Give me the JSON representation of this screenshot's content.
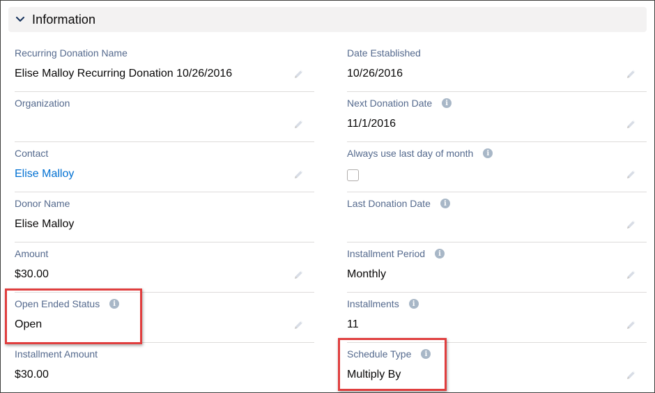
{
  "section": {
    "title": "Information",
    "toggle_icon": "chevron-down-icon"
  },
  "left_fields": [
    {
      "label": "Recurring Donation Name",
      "value": "Elise Malloy Recurring Donation 10/26/2016",
      "info": false
    },
    {
      "label": "Organization",
      "value": "",
      "info": false
    },
    {
      "label": "Contact",
      "value": "Elise Malloy",
      "info": false,
      "link": true
    },
    {
      "label": "Donor Name",
      "value": "Elise Malloy",
      "info": false
    },
    {
      "label": "Amount",
      "value": "$30.00",
      "info": false
    },
    {
      "label": "Open Ended Status",
      "value": "Open",
      "info": true,
      "highlighted": true
    },
    {
      "label": "Installment Amount",
      "value": "$30.00",
      "info": false
    }
  ],
  "right_fields": [
    {
      "label": "Date Established",
      "value": "10/26/2016",
      "info": false
    },
    {
      "label": "Next Donation Date",
      "value": "11/1/2016",
      "info": true
    },
    {
      "label": "Always use last day of month",
      "value": "",
      "info": true,
      "checkbox": true,
      "checked": false
    },
    {
      "label": "Last Donation Date",
      "value": "",
      "info": true
    },
    {
      "label": "Installment Period",
      "value": "Monthly",
      "info": true
    },
    {
      "label": "Installments",
      "value": "11",
      "info": true
    },
    {
      "label": "Schedule Type",
      "value": "Multiply By",
      "info": true,
      "highlighted": true
    }
  ],
  "icons": {
    "edit": "pencil-edit-icon",
    "info": "info-icon",
    "info_glyph": "i"
  },
  "colors": {
    "label": "#54698d",
    "value": "#080707",
    "link": "#0070d2",
    "highlight": "#e03e3e",
    "header_bg": "#f3f2f2"
  }
}
